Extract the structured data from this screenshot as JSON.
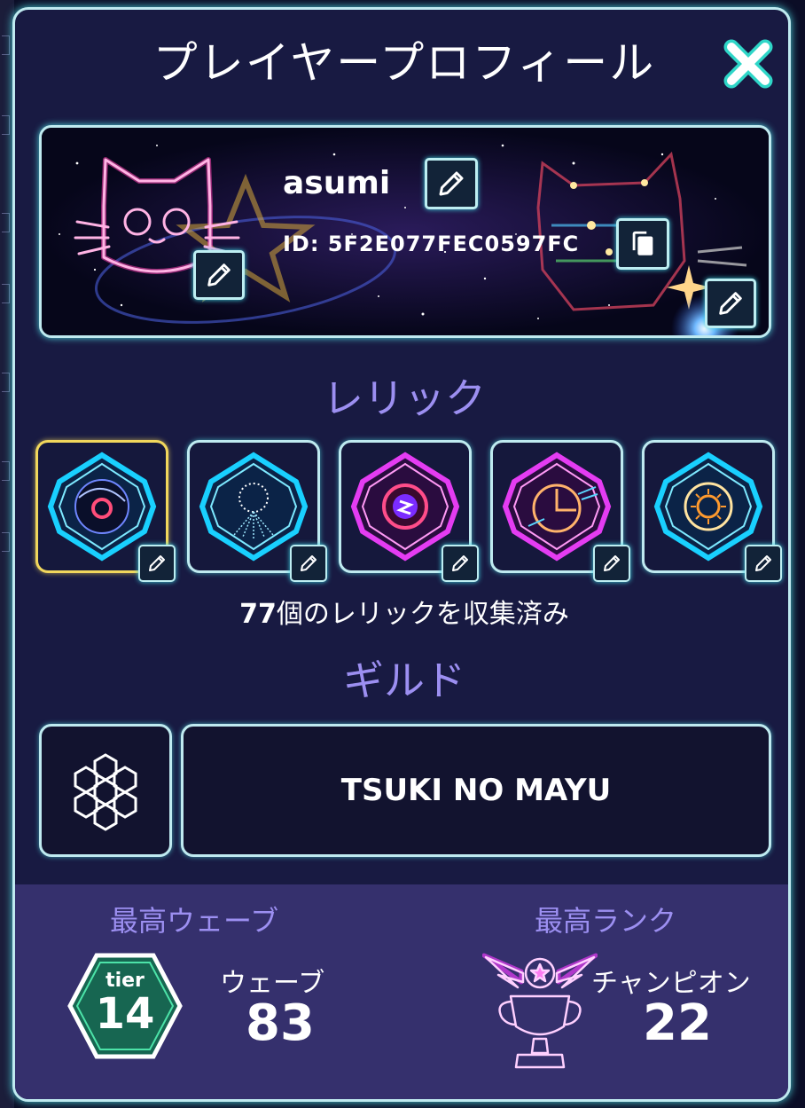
{
  "dialog": {
    "title": "プレイヤープロフィール",
    "close_icon": "close-icon"
  },
  "profile": {
    "username": "asumi",
    "player_id": "ID: 5F2E077FEC0597FC",
    "avatar_icon": "neon-cat-icon",
    "banner_icon": "neon-cat-constellation"
  },
  "relics": {
    "title": "レリック",
    "items": [
      {
        "icon": "black-hole-relic-icon",
        "selected": true
      },
      {
        "icon": "fireworks-sphere-relic-icon",
        "selected": false
      },
      {
        "icon": "energy-orb-relic-icon",
        "selected": false
      },
      {
        "icon": "clock-relic-icon",
        "selected": false
      },
      {
        "icon": "sun-relic-icon",
        "selected": false
      }
    ],
    "count": "77",
    "count_suffix": "個のレリックを収集済み"
  },
  "guild": {
    "title": "ギルド",
    "icon": "hexagon-cluster-icon",
    "name": "TSUKI NO MAYU"
  },
  "stats": {
    "best_wave": {
      "title": "最高ウェーブ",
      "tier_label": "tier",
      "tier_value": "14",
      "label": "ウェーブ",
      "value": "83"
    },
    "best_rank": {
      "title": "最高ランク",
      "icon": "winged-trophy-icon",
      "label": "チャンピオン",
      "value": "22"
    }
  },
  "colors": {
    "panel_bg": "#181a42",
    "neon_border": "#bfeaf0",
    "section_title": "#9c8ff1",
    "stats_bg": "#35306d",
    "selected_border": "#f1d75c",
    "cyan_neon": "#2fd6f0",
    "magenta_neon": "#e43cf2"
  }
}
